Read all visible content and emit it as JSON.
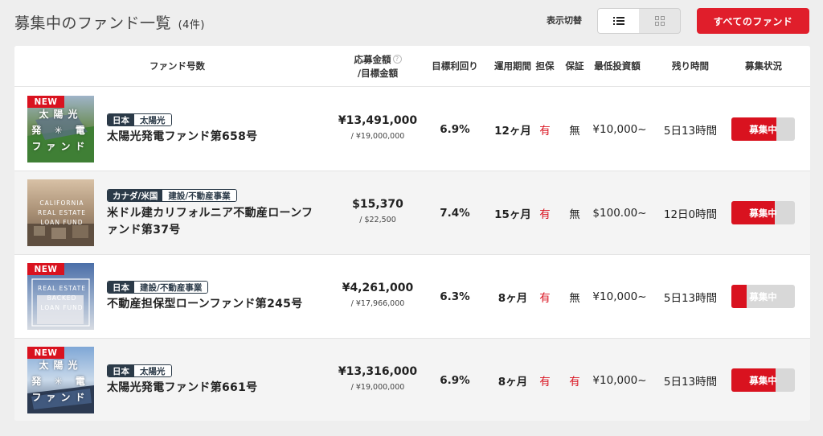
{
  "header": {
    "title": "募集中のファンド一覧",
    "count": "(4件)",
    "view_label": "表示切替",
    "list_view_icon": "list-icon",
    "grid_view_icon": "grid-icon",
    "all_funds_button": "すべてのファンド"
  },
  "table": {
    "columns": {
      "fund": "ファンド号数",
      "amount_line1": "応募金額",
      "amount_line2": "/目標金額",
      "amount_help": "?",
      "yield": "目標利回り",
      "period": "運用期間",
      "collateral": "担保",
      "guarantee": "保証",
      "min_investment": "最低投資額",
      "time_left": "残り時間",
      "status": "募集状況"
    },
    "rows": [
      {
        "is_new": true,
        "new_label": "NEW",
        "thumb_theme": "solar",
        "thumb_lines": [
          "太陽光",
          "発 ✳ 電",
          "ファンド"
        ],
        "country": "日本",
        "category": "太陽光",
        "name": "太陽光発電ファンド第658号",
        "amount": "¥13,491,000",
        "target": "/ ¥19,000,000",
        "yield": "6.9%",
        "period": "12ヶ月",
        "collateral": "有",
        "guarantee": "無",
        "min_investment": "¥10,000~",
        "time_left": "5日13時間",
        "status": "募集中",
        "progress": 0.71
      },
      {
        "is_new": false,
        "new_label": "",
        "thumb_theme": "california",
        "thumb_lines": [
          "CALIFORNIA",
          "REAL ESTATE",
          "LOAN FUND"
        ],
        "country": "カナダ/米国",
        "category": "建設/不動産事業",
        "name": "米ドル建カリフォルニア不動産ローンファンド第37号",
        "amount": "$15,370",
        "target": "/ $22,500",
        "yield": "7.4%",
        "period": "15ヶ月",
        "collateral": "有",
        "guarantee": "無",
        "min_investment": "$100.00~",
        "time_left": "12日0時間",
        "status": "募集中",
        "progress": 0.68
      },
      {
        "is_new": true,
        "new_label": "NEW",
        "thumb_theme": "realestate",
        "thumb_lines": [
          "REAL ESTATE",
          "BACKED",
          "LOAN FUND"
        ],
        "country": "日本",
        "category": "建設/不動産事業",
        "name": "不動産担保型ローンファンド第245号",
        "amount": "¥4,261,000",
        "target": "/ ¥17,966,000",
        "yield": "6.3%",
        "period": "8ヶ月",
        "collateral": "有",
        "guarantee": "無",
        "min_investment": "¥10,000~",
        "time_left": "5日13時間",
        "status": "募集中",
        "progress": 0.24
      },
      {
        "is_new": true,
        "new_label": "NEW",
        "thumb_theme": "solar2",
        "thumb_lines": [
          "太陽光",
          "発 ✳ 電",
          "ファンド"
        ],
        "country": "日本",
        "category": "太陽光",
        "name": "太陽光発電ファンド第661号",
        "amount": "¥13,316,000",
        "target": "/ ¥19,000,000",
        "yield": "6.9%",
        "period": "8ヶ月",
        "collateral": "有",
        "guarantee": "有",
        "min_investment": "¥10,000~",
        "time_left": "5日13時間",
        "status": "募集中",
        "progress": 0.7
      }
    ]
  },
  "colors": {
    "accent": "#e01e2b",
    "tag_dark": "#2b3a48",
    "progress_track": "#d8d8d8"
  }
}
